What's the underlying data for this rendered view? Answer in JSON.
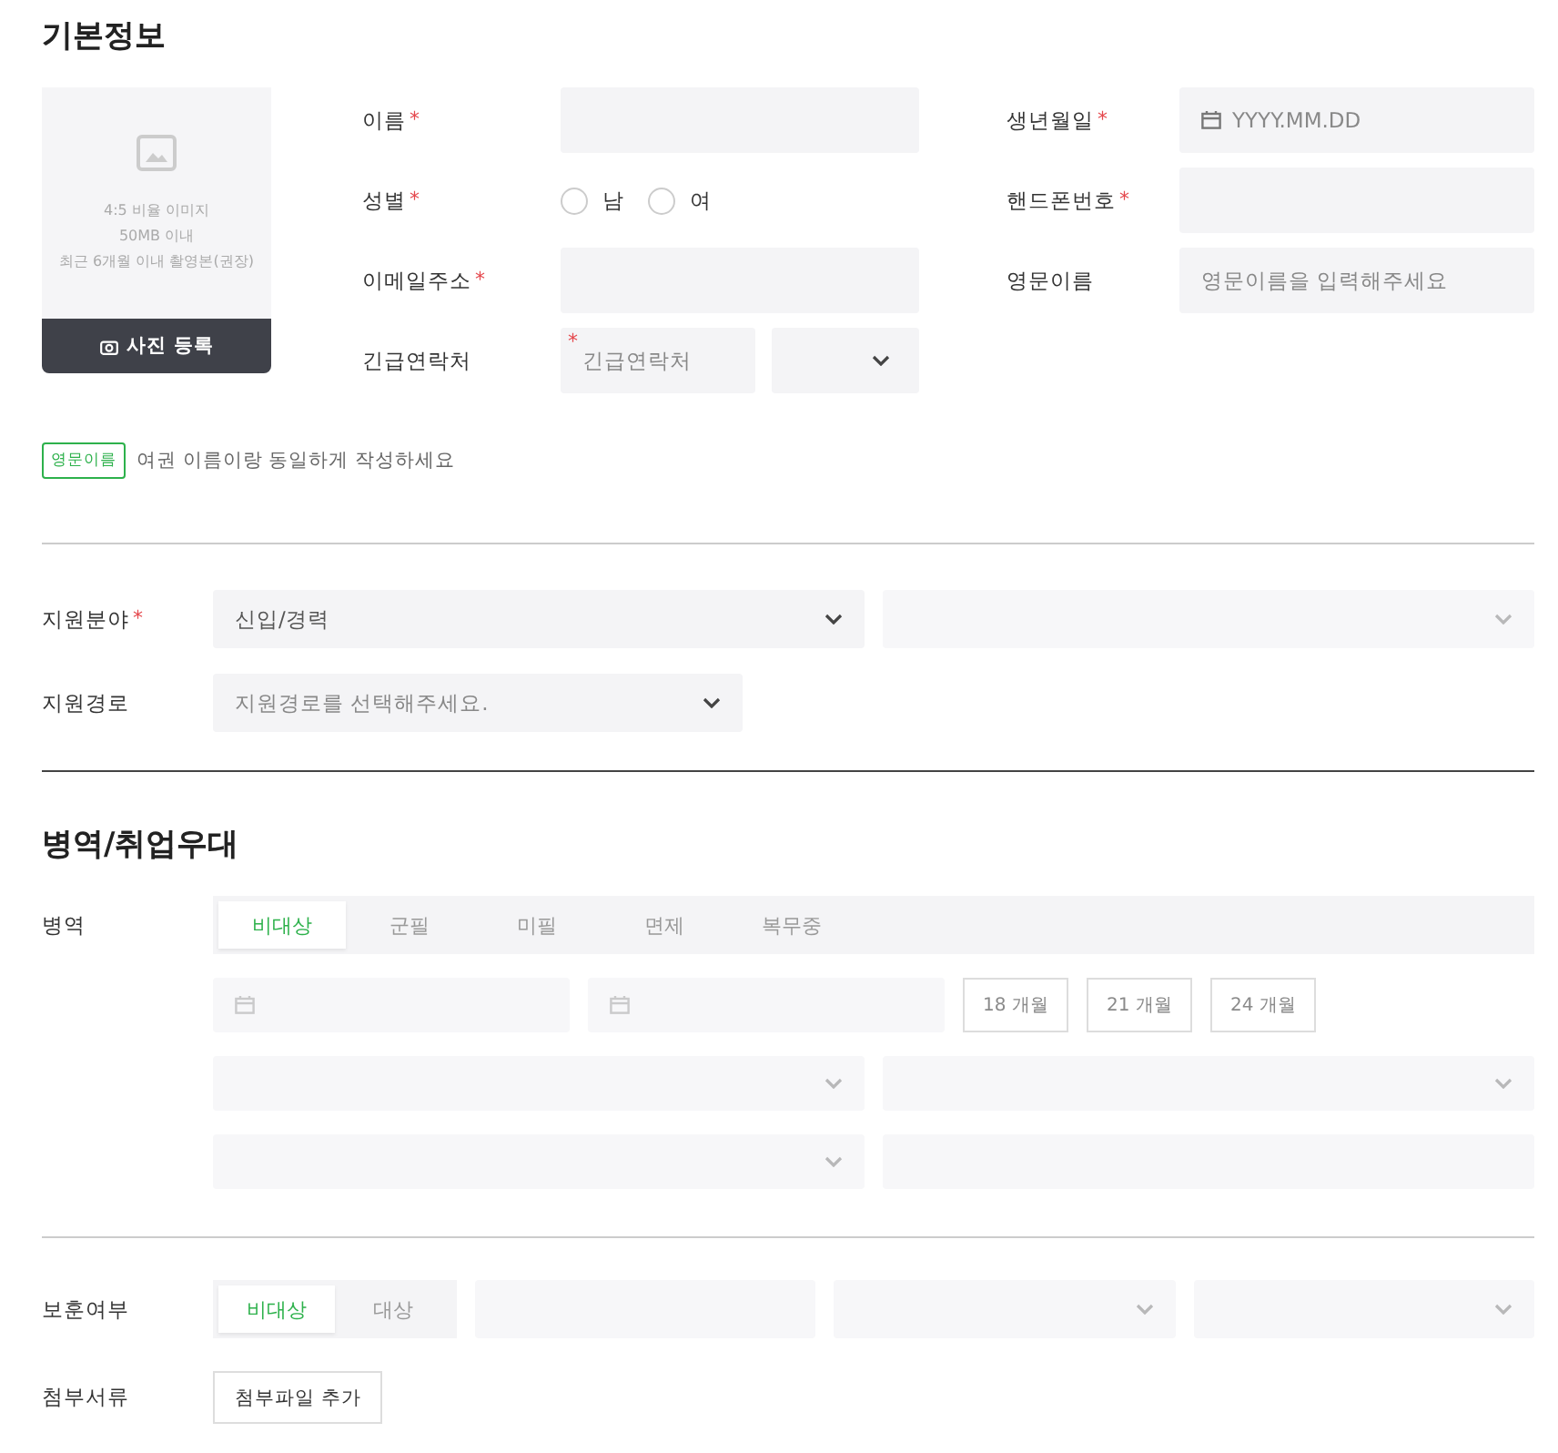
{
  "basic_info": {
    "title": "기본정보",
    "photo": {
      "hints": [
        "4:5 비율 이미지",
        "50MB 이내",
        "최근 6개월 이내 촬영본(권장)"
      ],
      "button": "사진 등록"
    },
    "fields": [
      {
        "kind": "text",
        "label": "이름",
        "required_mark": "*"
      },
      {
        "kind": "date",
        "label": "생년월일",
        "required_mark": "*",
        "placeholder": "YYYY.MM.DD"
      },
      {
        "kind": "radio",
        "label": "성별",
        "required_mark": "*",
        "options": [
          {
            "label": "남",
            "selected": false
          },
          {
            "label": "여",
            "selected": false
          }
        ]
      },
      {
        "kind": "text",
        "label": "핸드폰번호",
        "required_mark": "*"
      },
      {
        "kind": "text",
        "label": "이메일주소",
        "required_mark": "*"
      },
      {
        "kind": "text",
        "label": "영문이름",
        "placeholder": "영문이름을 입력해주세요"
      },
      {
        "kind": "contact",
        "label": "긴급연락처",
        "required_mark": "*",
        "placeholder": "긴급연락처"
      }
    ],
    "note": {
      "tag": "영문이름",
      "text": "여권 이름이랑 동일하게 작성하세요"
    }
  },
  "application": {
    "rows": [
      {
        "label": "지원분야",
        "required_mark": "*",
        "selects": [
          {
            "value": "신입/경력",
            "disabled": false
          },
          {
            "disabled": true
          }
        ]
      },
      {
        "label": "지원경로",
        "selects": [
          {
            "placeholder": "지원경로를 선택해주세요.",
            "disabled": false
          }
        ]
      }
    ]
  },
  "military": {
    "title": "병역/취업우대",
    "service": {
      "label": "병역",
      "options": [
        {
          "label": "비대상",
          "selected": true
        },
        {
          "label": "군필",
          "selected": false
        },
        {
          "label": "미필",
          "selected": false
        },
        {
          "label": "면제",
          "selected": false
        },
        {
          "label": "복무중",
          "selected": false
        }
      ],
      "details": [
        [
          {
            "kind": "date",
            "disabled": true
          },
          {
            "kind": "date",
            "disabled": true
          },
          {
            "kind": "button",
            "label": "18 개월",
            "disabled": true
          },
          {
            "kind": "button",
            "label": "21 개월",
            "disabled": true
          },
          {
            "kind": "button",
            "label": "24 개월",
            "disabled": true
          }
        ],
        [
          {
            "kind": "select",
            "disabled": true
          },
          {
            "kind": "select",
            "disabled": true
          }
        ],
        [
          {
            "kind": "select",
            "disabled": true
          },
          {
            "kind": "input",
            "disabled": true
          }
        ]
      ]
    },
    "veteran": {
      "label": "보훈여부",
      "options": [
        {
          "label": "비대상",
          "selected": true
        },
        {
          "label": "대상",
          "selected": false
        }
      ],
      "fields": [
        {
          "kind": "input",
          "disabled": true
        },
        {
          "kind": "select",
          "disabled": true
        },
        {
          "kind": "select",
          "disabled": true
        }
      ]
    },
    "attachments": {
      "label": "첨부서류",
      "button": "첨부파일 추가"
    }
  }
}
